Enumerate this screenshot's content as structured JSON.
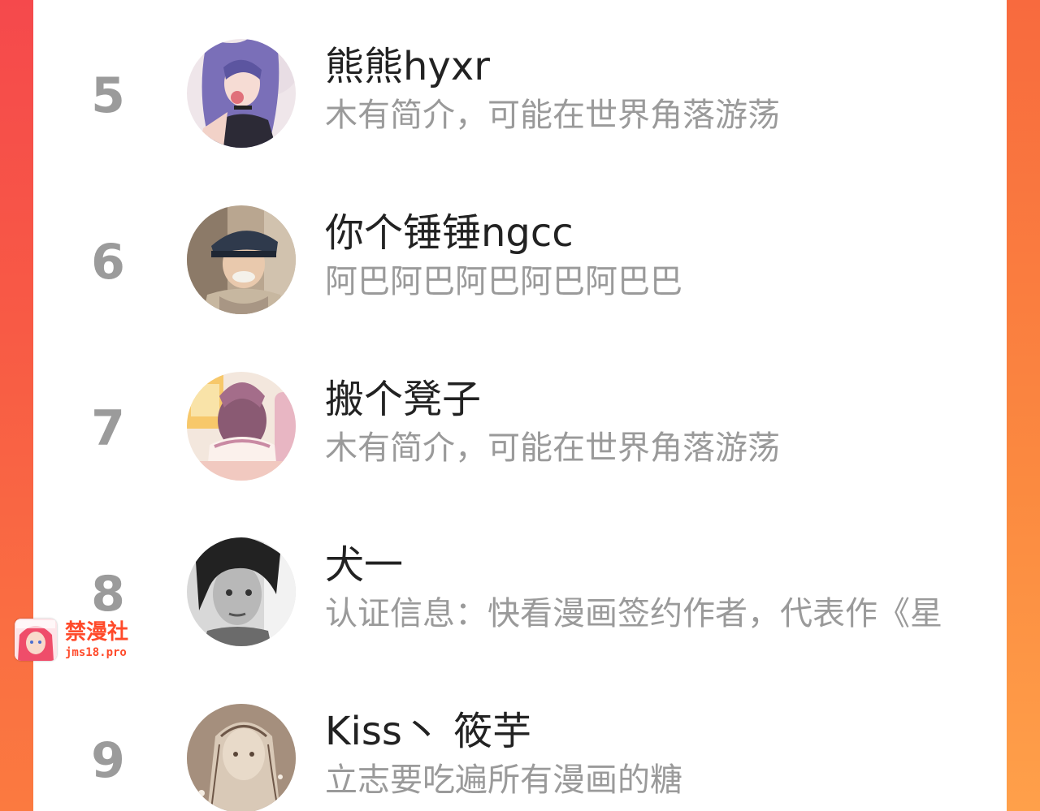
{
  "ranking": {
    "items": [
      {
        "rank": "5",
        "name": "熊熊hyxr",
        "desc": "木有简介，可能在世界角落游荡",
        "avatar": "anime-girl-avatar"
      },
      {
        "rank": "6",
        "name": "你个锤锤ngcc",
        "desc": "阿巴阿巴阿巴阿巴阿巴巴",
        "avatar": "photo-boy-cap-avatar"
      },
      {
        "rank": "7",
        "name": "搬个凳子",
        "desc": "木有简介，可能在世界角落游荡",
        "avatar": "illustrated-girl-back-avatar"
      },
      {
        "rank": "8",
        "name": "犬一",
        "desc": "认证信息：快看漫画签约作者，代表作《星",
        "avatar": "grayscale-portrait-avatar"
      },
      {
        "rank": "9",
        "name": "Kiss丶 筱芋",
        "desc": "立志要吃遍所有漫画的糖",
        "avatar": "sketch-girl-avatar"
      }
    ]
  },
  "watermark": {
    "title": "禁漫社",
    "url": "jms18.pro"
  },
  "colors": {
    "background_left": "#f5494c",
    "background_right": "#fb8a40",
    "rank": "#9b9b9b",
    "name": "#222222",
    "desc": "#9a9a9a",
    "watermark": "#ff4a2a"
  }
}
